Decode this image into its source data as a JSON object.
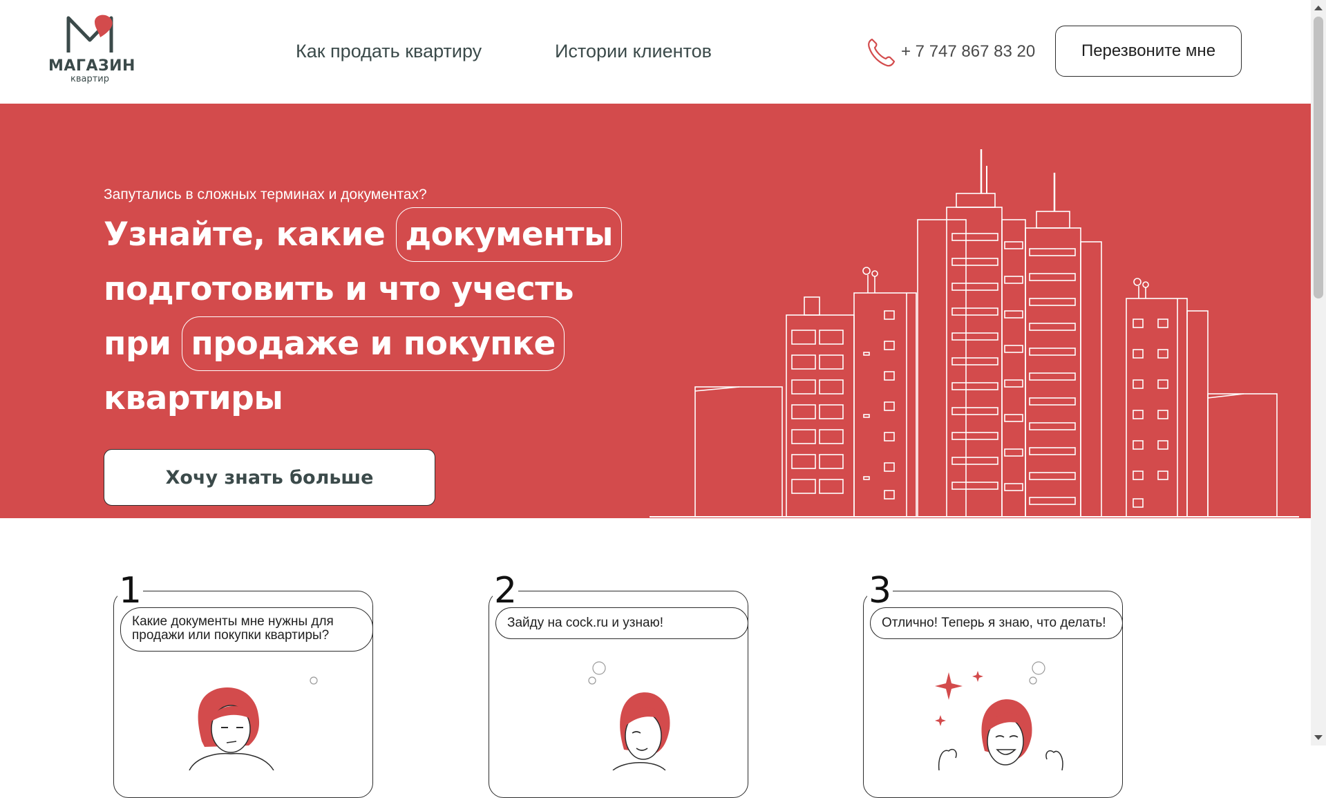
{
  "colors": {
    "brand_red": "#d34b4c",
    "text_dark": "#3b4a4a",
    "white": "#ffffff"
  },
  "header": {
    "logo": {
      "title": "МАГАЗИН",
      "subtitle": "квартир",
      "icon": "m-heart-logo-icon"
    },
    "nav": [
      {
        "label": "Как продать квартиру"
      },
      {
        "label": "Истории клиентов"
      }
    ],
    "phone": {
      "icon": "phone-icon",
      "number": "+ 7 747 867 83 20"
    },
    "callback_label": "Перезвоните мне"
  },
  "hero": {
    "subtitle": "Запутались в сложных терминах и документах?",
    "title_parts": {
      "p1": "Узнайте, какие ",
      "hl1": "документы",
      "p2": "подготовить и что учесть",
      "p3": "при ",
      "hl2": "продаже и покупке",
      "p4": "квартиры"
    },
    "cta_label": "Хочу знать больше",
    "illustration": "city-buildings-line-art"
  },
  "steps": [
    {
      "number": "1",
      "text": "Какие документы мне нужны для продажи или покупки квартиры?",
      "illustration": "thinking-woman"
    },
    {
      "number": "2",
      "text": "Зайду на cock.ru и узнаю!",
      "illustration": "smiling-woman"
    },
    {
      "number": "3",
      "text": "Отлично! Теперь я знаю, что делать!",
      "illustration": "happy-woman-sparkles"
    }
  ]
}
